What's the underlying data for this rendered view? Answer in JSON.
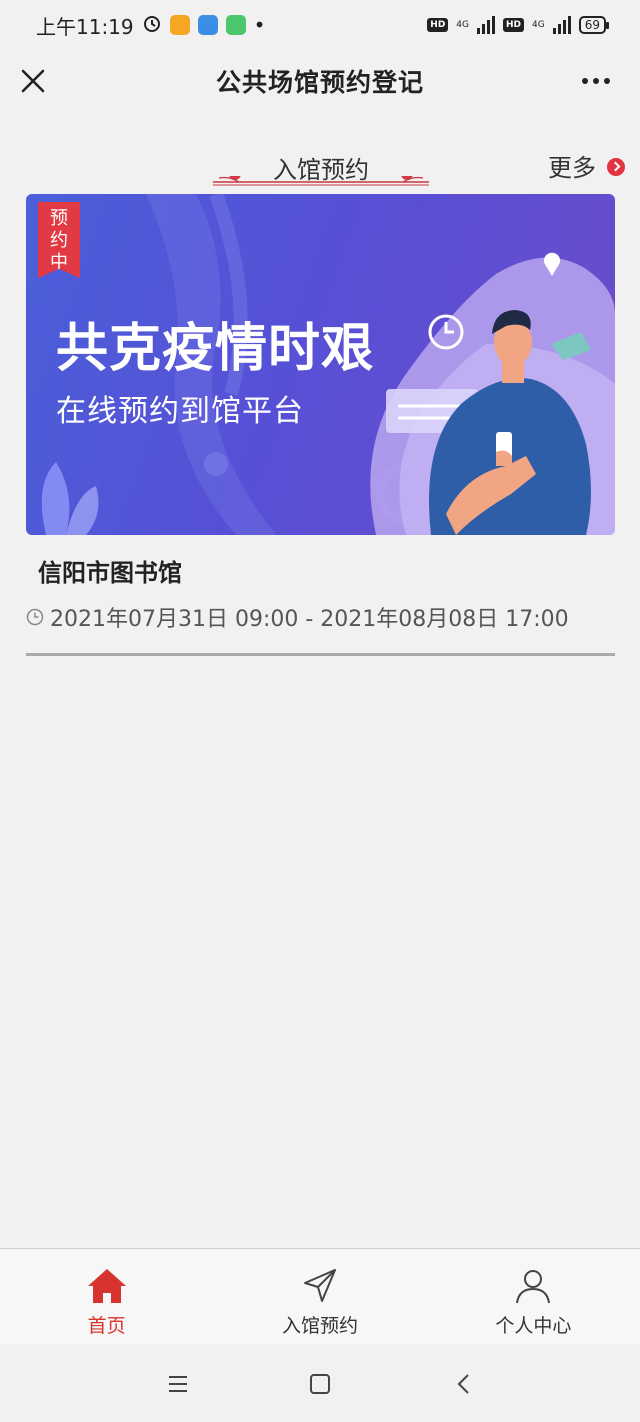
{
  "status_bar": {
    "time": "上午11:19",
    "network_1": "4G",
    "network_2": "4G",
    "hd_1": "HD",
    "hd_2": "HD",
    "battery": "69"
  },
  "header": {
    "title": "公共场馆预约登记"
  },
  "section": {
    "title": "入馆预约",
    "more_label": "更多"
  },
  "banner": {
    "badge": [
      "预",
      "约",
      "中"
    ],
    "headline": "共克疫情时艰",
    "subline": "在线预约到馆平台"
  },
  "venue": {
    "name": "信阳市图书馆",
    "time_range": "2021年07月31日 09:00 - 2021年08月08日 17:00"
  },
  "tabbar": {
    "items": [
      {
        "label": "首页",
        "icon": "home-icon",
        "active": true
      },
      {
        "label": "入馆预约",
        "icon": "send-icon",
        "active": false
      },
      {
        "label": "个人中心",
        "icon": "user-icon",
        "active": false
      }
    ]
  },
  "colors": {
    "accent": "#d8342f",
    "banner_start": "#4b5fd8",
    "banner_end": "#6c4cc9",
    "background": "#f1f1f1"
  }
}
